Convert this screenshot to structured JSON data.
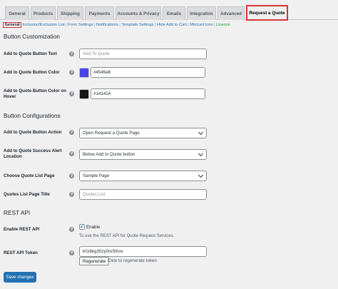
{
  "tabs": [
    {
      "label": "General"
    },
    {
      "label": "Products"
    },
    {
      "label": "Shipping"
    },
    {
      "label": "Payments"
    },
    {
      "label": "Accounts & Privacy"
    },
    {
      "label": "Emails"
    },
    {
      "label": "Integration"
    },
    {
      "label": "Advanced"
    },
    {
      "label": "Request a Quote",
      "active": true
    }
  ],
  "subnav": {
    "active": "General",
    "links": [
      "Inclusion/Exclusion List",
      "Form Settings",
      "Notifications",
      "Template Settings",
      "Hide Add to Cart",
      "Minicart Icon",
      "Licence"
    ],
    "sep": "|"
  },
  "help_glyph": "?",
  "sections": {
    "button_customization": "Button Customization",
    "button_configurations": "Button Configurations",
    "rest_api": "REST API"
  },
  "fields": {
    "button_text": {
      "label": "Add to Quote Button Text",
      "placeholder": "Add To Quote"
    },
    "button_color": {
      "label": "Add to Quote Button Color",
      "value": "#4545e6",
      "color": "#4545e6"
    },
    "button_hover": {
      "label": "Add to Quote Button Color on Hover",
      "value": "#141414",
      "color": "#141414"
    },
    "button_action": {
      "label": "Add to Quote Button Action",
      "value": "Open Request a Quote Page"
    },
    "alert_location": {
      "label": "Add to Quote Success Alert Location",
      "value": "Below Add to Quote button"
    },
    "quote_page": {
      "label": "Choose Quote List Page",
      "value": "Sample Page"
    },
    "page_title": {
      "label": "Quotes List Page Title",
      "placeholder": "Quotes List"
    },
    "enable_rest": {
      "label": "Enable REST API",
      "checkbox_label": "Enable",
      "checked": true,
      "description": "To use the REST API for Quote Request Services."
    },
    "rest_token": {
      "label": "REST API Token",
      "value": "k0zbkg30zy0re5thov",
      "regenerate_label": "Regenerate",
      "hint": "Click to regenerate token"
    }
  },
  "save_label": "Save changes",
  "colors": {
    "accent": "#2271b1",
    "highlight": "#d63638",
    "licence": "#00a32a"
  }
}
